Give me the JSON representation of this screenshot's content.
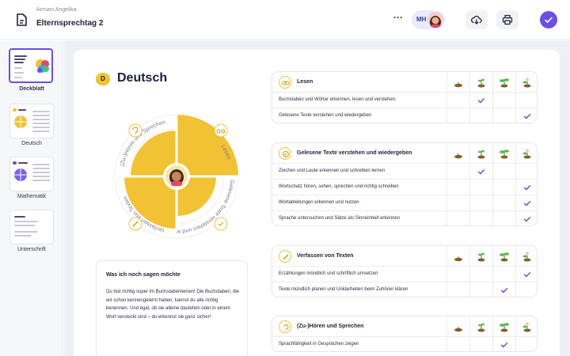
{
  "header": {
    "subtitle": "Armani Angelika",
    "title": "Elternsprechtag 2",
    "more_label": "···",
    "avatar_initials": "MH"
  },
  "sidebar": {
    "items": [
      {
        "label": "Deckblatt",
        "active": true
      },
      {
        "label": "Deutsch",
        "active": false
      },
      {
        "label": "Mathematik",
        "active": false
      },
      {
        "label": "Unterschrift",
        "active": false
      }
    ]
  },
  "subject": {
    "badge": "D",
    "title": "Deutsch"
  },
  "wheel": {
    "labels": [
      "(Zu-)Hören und Sprechen",
      "Lesen",
      "Gelesene Texte verstehen und wied...",
      "Verfassen von Texten"
    ]
  },
  "note": {
    "title": "Was ich noch sagen möchte",
    "text": "Du bist richtig super im Buchstabenlernen! Die Buchstaben, die wir schon kennengelernt haben, kannst du alle richtig benennen. Und egal, ob sie alleine dastehen oder in einem Wort versteckt sind – du erkennst sie ganz sicher!"
  },
  "colors": {
    "accent": "#6c4fe0",
    "petal": "#f1c234",
    "check": "#5b3fd6"
  },
  "sections": [
    {
      "icon": "glasses-icon",
      "title": "Lesen",
      "rows": [
        {
          "text": "Buchstaben und Wörter erkennen, lesen und verstehen.",
          "level": 2
        },
        {
          "text": "Gelesene Texte verstehen und wiedergeben",
          "level": 4
        }
      ]
    },
    {
      "icon": "check-circle-icon",
      "title": "Gelesene Texte verstehen und wiedergeben",
      "rows": [
        {
          "text": "Zeichen und Laute erkennen und schreiben lernen",
          "level": 2
        },
        {
          "text": "Wortschatz hören, sehen, sprechen und richtig schreiben",
          "level": 4
        },
        {
          "text": "Wortableitungen erkennen und nutzen",
          "level": 4
        },
        {
          "text": "Sprache untersuchen und Sätze als Sinneinheit erkennen",
          "level": 4
        }
      ]
    },
    {
      "icon": "pencil-icon",
      "title": "Verfassen von Texten",
      "rows": [
        {
          "text": "Erzählungen mündlich und schriftlich umsetzen",
          "level": 4
        },
        {
          "text": "Texte mündlich planen und Unklarheiten beim Zuhören klären",
          "level": 3
        }
      ]
    },
    {
      "icon": "ear-icon",
      "title": "(Zu-)Hören und Sprechen",
      "rows": [
        {
          "text": "Sprachfähigkeit in Gesprächen zeigen",
          "level": 3
        }
      ]
    }
  ]
}
